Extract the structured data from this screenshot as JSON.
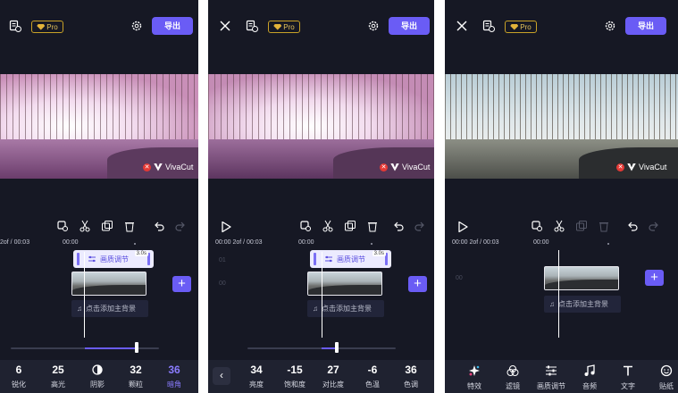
{
  "screens": [
    {
      "top": {
        "pro_label": "Pro"
      },
      "watermark": "VivaCut",
      "timecode": "2of / 00:03",
      "ruler_mark": "00:00",
      "clip_label": "画质调节",
      "clip_duration": "3.0s",
      "music_hint": "点击添加主背景",
      "adjust_value_fraction": 0.85,
      "adjustments": [
        {
          "value": "6",
          "label": "锐化"
        },
        {
          "value": "25",
          "label": "高光"
        },
        {
          "value": "",
          "label": "阴影",
          "icon": "contrast-circle-icon"
        },
        {
          "value": "32",
          "label": "颗粒"
        },
        {
          "value": "36",
          "label": "暗角",
          "active": true
        }
      ]
    },
    {
      "top": {
        "pro_label": "Pro",
        "export_label": "导出"
      },
      "watermark": "VivaCut",
      "timecode": "00:00 2of / 00:03",
      "ruler_mark": "00:00",
      "ghost_marks": [
        "01",
        "00"
      ],
      "clip_label": "画质调节",
      "clip_duration": "3.0s",
      "music_hint": "点击添加主背景",
      "adjust_value_fraction": 0.6,
      "adjustments": [
        {
          "value": "34",
          "label": "亮度"
        },
        {
          "value": "-15",
          "label": "饱和度"
        },
        {
          "value": "27",
          "label": "对比度"
        },
        {
          "value": "-6",
          "label": "色温"
        },
        {
          "value": "36",
          "label": "色调"
        }
      ]
    },
    {
      "top": {
        "pro_label": "Pro",
        "export_label": "导出"
      },
      "watermark": "VivaCut",
      "timecode": "00:00 2of / 00:03",
      "ruler_mark": "00:00",
      "ghost_marks": [
        "00"
      ],
      "music_hint": "点击添加主背景",
      "tools": [
        {
          "label": "特效",
          "icon": "sparkle-icon"
        },
        {
          "label": "滤镜",
          "icon": "filter-circles-icon"
        },
        {
          "label": "画质调节",
          "icon": "sliders-icon"
        },
        {
          "label": "音频",
          "icon": "music-note-icon"
        },
        {
          "label": "文字",
          "icon": "text-icon"
        },
        {
          "label": "贴纸",
          "icon": "sticker-icon"
        }
      ]
    }
  ],
  "colors": {
    "accent": "#6a5cf5",
    "panel_bg": "#161824",
    "active_adjust": "#8a7cff"
  }
}
